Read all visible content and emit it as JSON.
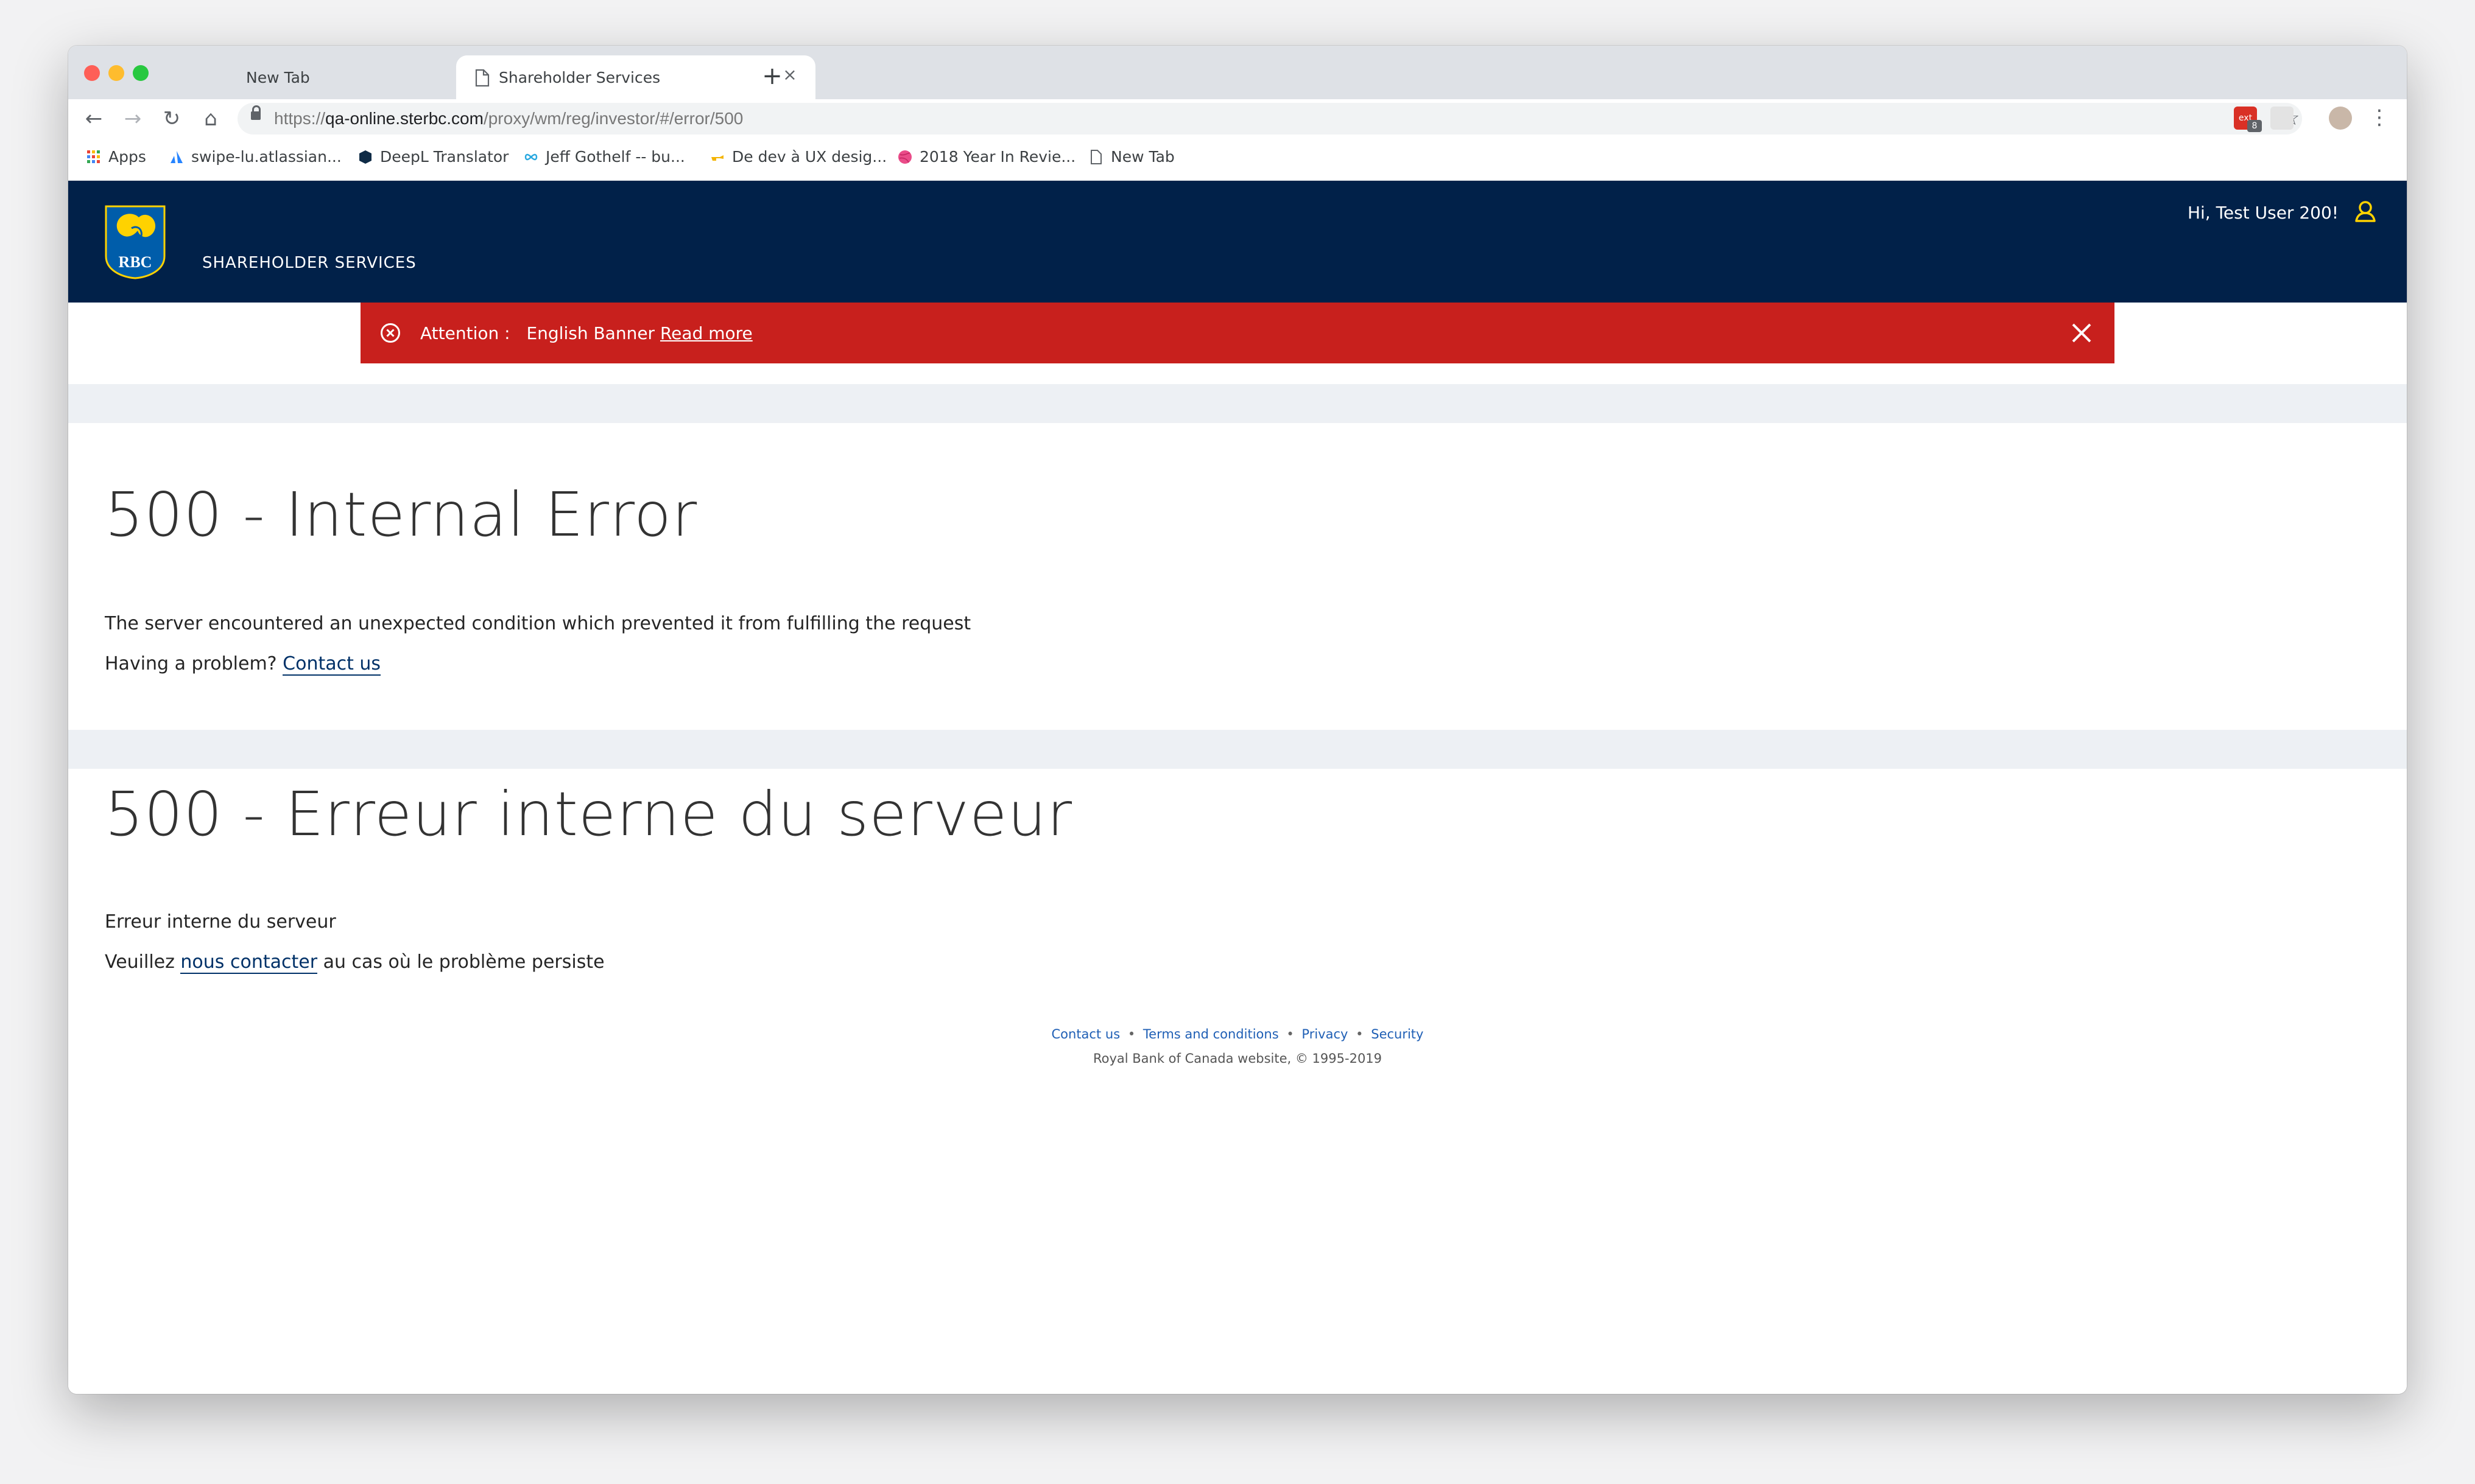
{
  "browser": {
    "tabs": [
      {
        "title": "New Tab",
        "active": false
      },
      {
        "title": "Shareholder Services",
        "active": true
      }
    ],
    "url": {
      "scheme": "https://",
      "host": "qa-online.sterbc.com",
      "path": "/proxy/wm/reg/investor/#/error/500"
    },
    "bookmarks": [
      {
        "label": "Apps",
        "icon": "apps-grid-icon"
      },
      {
        "label": "swipe-lu.atlassian...",
        "icon": "atlassian-icon"
      },
      {
        "label": "DeepL Translator",
        "icon": "deepl-icon"
      },
      {
        "label": "Jeff Gothelf -- bu...",
        "icon": "infinity-icon"
      },
      {
        "label": "De dev à UX desig...",
        "icon": "hand-icon"
      },
      {
        "label": "2018 Year In Revie...",
        "icon": "dribbble-icon"
      },
      {
        "label": "New Tab",
        "icon": "page-icon"
      }
    ],
    "extension_badge": "8"
  },
  "header": {
    "logo_text": "RBC",
    "site_title": "SHAREHOLDER SERVICES",
    "greeting": "Hi, Test User 200!"
  },
  "banner": {
    "label": "Attention :",
    "message": "English Banner",
    "link": "Read more",
    "color": "#c8201d"
  },
  "error_en": {
    "title": "500 - Internal Error",
    "description": "The server encountered an unexpected condition which prevented it from fulfilling the request",
    "help_prefix": "Having a problem?",
    "help_link": "Contact us"
  },
  "error_fr": {
    "title": "500 - Erreur interne du serveur",
    "description": "Erreur interne du serveur",
    "help_prefix": "Veuillez",
    "help_link": "nous contacter",
    "help_suffix": "au cas où le problème persiste"
  },
  "footer": {
    "links": [
      "Contact us",
      "Terms and conditions",
      "Privacy",
      "Security"
    ],
    "separator": "•",
    "copyright": "Royal Bank of Canada website, © 1995-2019"
  },
  "colors": {
    "header_bg": "#012149",
    "accent_gold": "#ffd200",
    "link": "#003168"
  }
}
